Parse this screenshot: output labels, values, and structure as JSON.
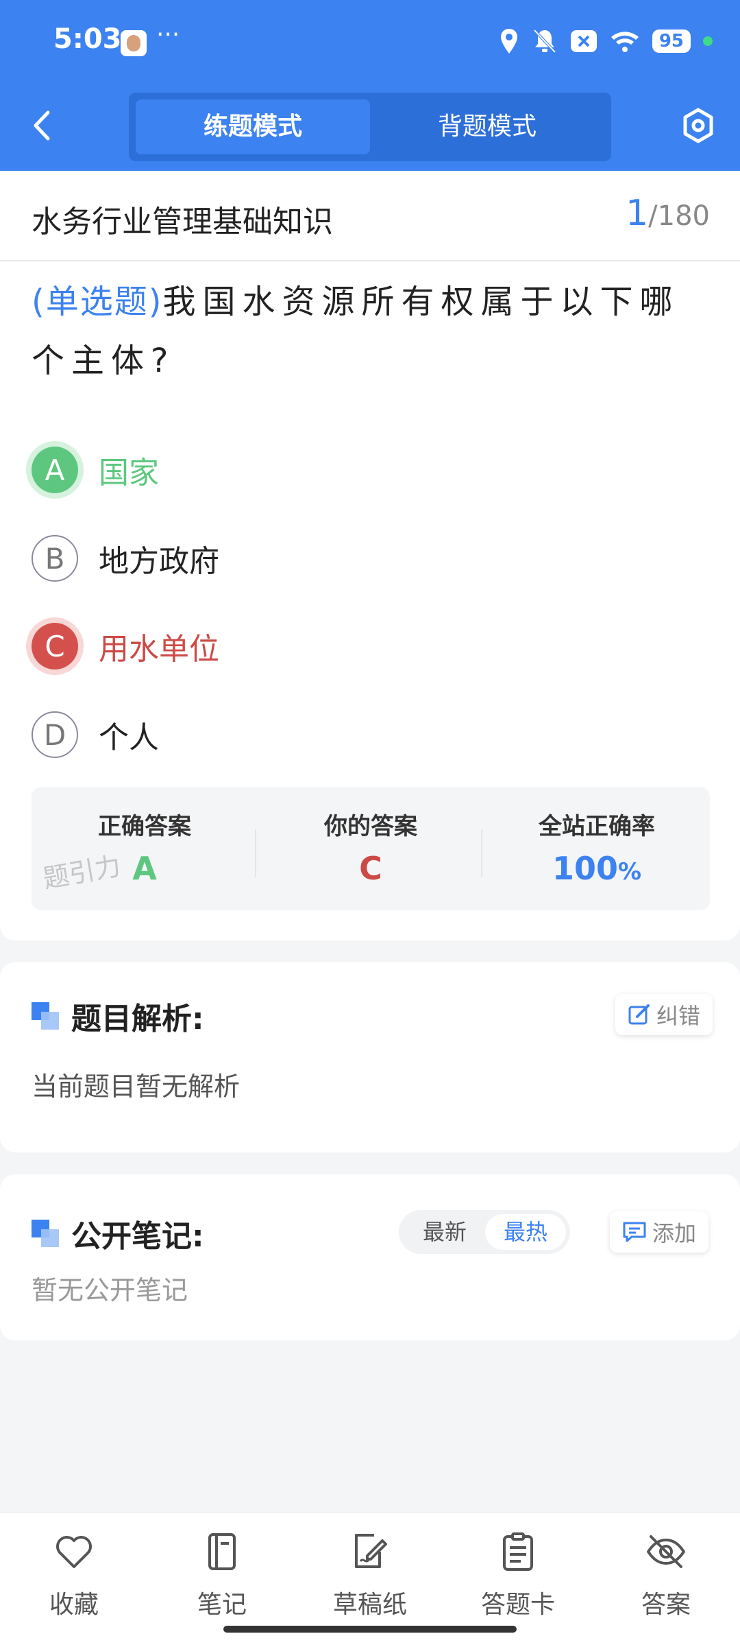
{
  "status_bar": {
    "time": "5:03",
    "dots": "···",
    "battery": "95"
  },
  "header": {
    "tab_practice": "练题模式",
    "tab_memorize": "背题模式"
  },
  "question": {
    "subject": "水务行业管理基础知识",
    "current": "1",
    "total": "/180",
    "type_label": "(单选题)",
    "text": "我国水资源所有权属于以下哪个主体?",
    "options": [
      {
        "letter": "A",
        "text": "国家",
        "state": "correct"
      },
      {
        "letter": "B",
        "text": "地方政府",
        "state": "normal"
      },
      {
        "letter": "C",
        "text": "用水单位",
        "state": "wrong"
      },
      {
        "letter": "D",
        "text": "个人",
        "state": "normal"
      }
    ]
  },
  "result": {
    "correct_label": "正确答案",
    "correct_value": "A",
    "yours_label": "你的答案",
    "yours_value": "C",
    "rate_label": "全站正确率",
    "rate_value": "100",
    "rate_unit": "%",
    "watermark": "题引力"
  },
  "analysis": {
    "title": "题目解析:",
    "correct_btn": "纠错",
    "empty_text": "当前题目暂无解析"
  },
  "notes": {
    "title": "公开笔记:",
    "sort_latest": "最新",
    "sort_hot": "最热",
    "add_btn": "添加",
    "empty_text": "暂无公开笔记"
  },
  "bottom_nav": [
    {
      "label": "收藏",
      "icon": "heart-icon"
    },
    {
      "label": "笔记",
      "icon": "notebook-icon"
    },
    {
      "label": "草稿纸",
      "icon": "draft-paper-icon"
    },
    {
      "label": "答题卡",
      "icon": "answer-card-icon"
    },
    {
      "label": "答案",
      "icon": "eye-off-icon"
    }
  ],
  "colors": {
    "primary": "#3c82f0",
    "correct": "#5ec77f",
    "wrong": "#d4504c"
  }
}
